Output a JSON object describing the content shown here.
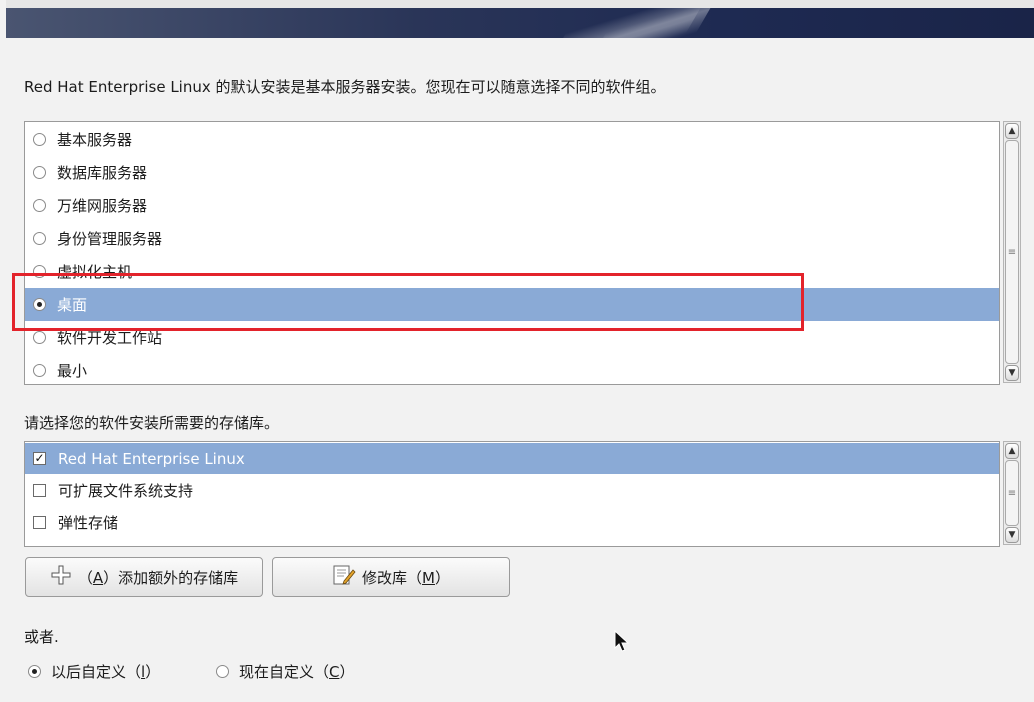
{
  "intro_text": "Red Hat Enterprise Linux 的默认安装是基本服务器安装。您现在可以随意选择不同的软件组。",
  "software_groups": [
    {
      "label": "基本服务器",
      "selected": false
    },
    {
      "label": "数据库服务器",
      "selected": false
    },
    {
      "label": "万维网服务器",
      "selected": false
    },
    {
      "label": "身份管理服务器",
      "selected": false
    },
    {
      "label": "虚拟化主机",
      "selected": false
    },
    {
      "label": "桌面",
      "selected": true
    },
    {
      "label": "软件开发工作站",
      "selected": false
    },
    {
      "label": "最小",
      "selected": false
    }
  ],
  "repo_prompt": "请选择您的软件安装所需要的存储库。",
  "repositories": [
    {
      "label": "Red Hat Enterprise Linux",
      "checked": true
    },
    {
      "label": "可扩展文件系统支持",
      "checked": false
    },
    {
      "label": "弹性存储",
      "checked": false
    }
  ],
  "buttons": {
    "add_repo_prefix": "（",
    "add_repo_key": "A",
    "add_repo_suffix": "）添加额外的存储库",
    "modify_repo_prefix": "修改库（",
    "modify_repo_key": "M",
    "modify_repo_suffix": "）"
  },
  "or_label": "或者.",
  "customize": {
    "later_prefix": "以后自定义（",
    "later_key": "l",
    "later_suffix": "）",
    "later_selected": true,
    "now_prefix": "现在自定义（",
    "now_key": "C",
    "now_suffix": "）",
    "now_selected": false
  },
  "colors": {
    "selection": "#8aaad6",
    "highlight_border": "#e3232b",
    "banner": "#1e2a52"
  },
  "icons": {
    "add": "plus-icon",
    "modify": "edit-icon"
  }
}
